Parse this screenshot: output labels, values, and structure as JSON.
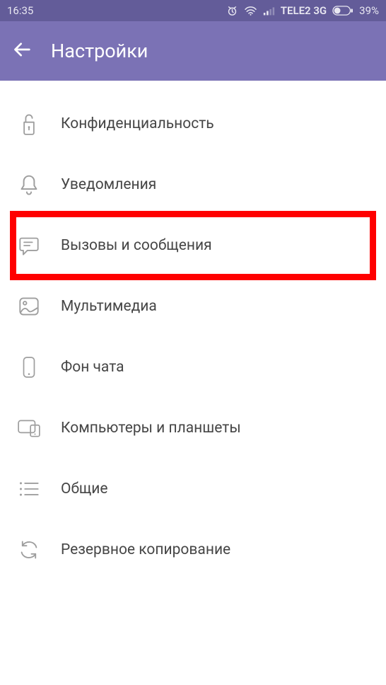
{
  "status": {
    "time": "16:35",
    "carrier": "TELE2 3G",
    "battery": "39%"
  },
  "appbar": {
    "title": "Настройки"
  },
  "menu": {
    "items": [
      {
        "key": "privacy",
        "label": "Конфиденциальность",
        "icon": "lock-icon",
        "hl": false
      },
      {
        "key": "notif",
        "label": "Уведомления",
        "icon": "bell-icon",
        "hl": false
      },
      {
        "key": "calls",
        "label": "Вызовы и сообщения",
        "icon": "chat-icon",
        "hl": true
      },
      {
        "key": "media",
        "label": "Мультимедиа",
        "icon": "media-icon",
        "hl": false
      },
      {
        "key": "bg",
        "label": "Фон чата",
        "icon": "phone-icon",
        "hl": false
      },
      {
        "key": "devices",
        "label": "Компьютеры и планшеты",
        "icon": "devices-icon",
        "hl": false
      },
      {
        "key": "general",
        "label": "Общие",
        "icon": "list-icon",
        "hl": false
      },
      {
        "key": "backup",
        "label": "Резервное копирование",
        "icon": "sync-icon",
        "hl": false
      }
    ]
  }
}
